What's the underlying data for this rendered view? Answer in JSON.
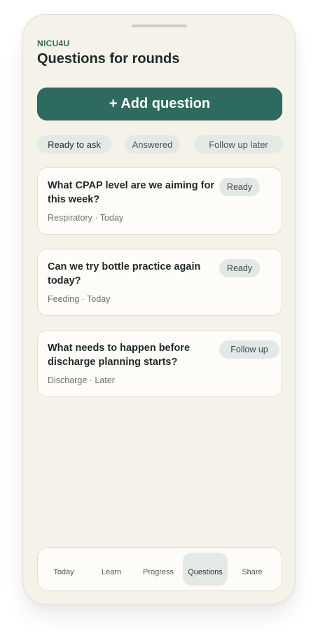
{
  "app": {
    "brand": "NICU4U",
    "title": "Questions for rounds"
  },
  "actions": {
    "add_question_label": "+ Add question"
  },
  "filters": [
    {
      "label": "Ready to ask",
      "selected": true
    },
    {
      "label": "Answered",
      "selected": false
    },
    {
      "label": "Follow up later",
      "selected": false
    }
  ],
  "questions": [
    {
      "text": "What CPAP level are we aiming for this week?",
      "category": "Respiratory",
      "when": "Today",
      "meta": "Respiratory · Today",
      "status": "Ready"
    },
    {
      "text": "Can we try bottle practice again today?",
      "category": "Feeding",
      "when": "Today",
      "meta": "Feeding · Today",
      "status": "Ready"
    },
    {
      "text": "What needs to happen before discharge planning starts?",
      "category": "Discharge",
      "when": "Later",
      "meta": "Discharge · Later",
      "status": "Follow up"
    }
  ],
  "nav": {
    "active": "Questions",
    "tabs": [
      {
        "label": "Today"
      },
      {
        "label": "Learn"
      },
      {
        "label": "Progress"
      },
      {
        "label": "Questions"
      },
      {
        "label": "Share"
      }
    ]
  },
  "colors": {
    "accent": "#2e6b5e",
    "background": "#f5f2ea",
    "card": "#fdfcf8",
    "chip": "#e5e9e6"
  }
}
